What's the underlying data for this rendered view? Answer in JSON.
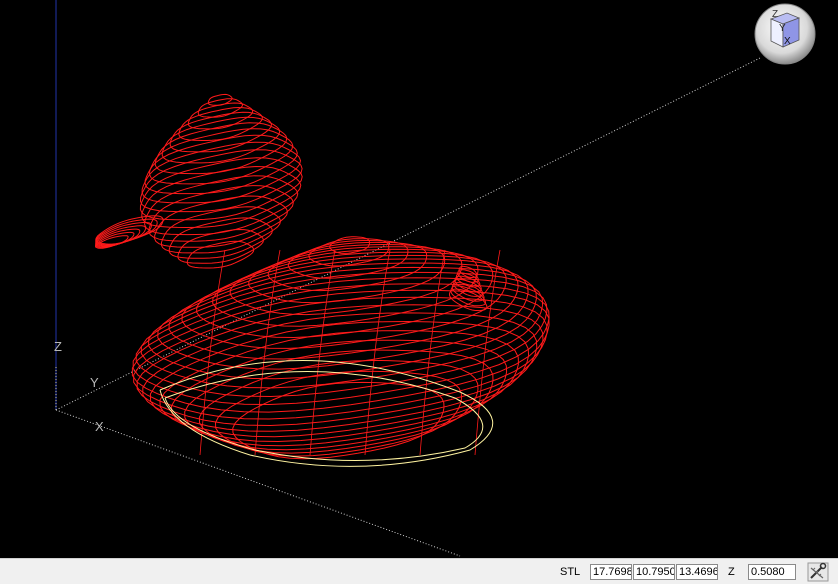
{
  "viewport": {
    "background": "#000000",
    "model_color": "#ff1a1a",
    "toolpath_color": "#fff3a0",
    "axis_labels": {
      "x": "X",
      "y": "Y",
      "z": "Z"
    }
  },
  "view_cube": {
    "top": "Z",
    "front": "Y",
    "right": "X",
    "color": "#8f95e6"
  },
  "statusbar": {
    "mode_label": "STL",
    "coord_x": "17.7698",
    "coord_y": "10.7950",
    "coord_z": "13.4696",
    "z_label": "Z",
    "z_value": "0.5080",
    "icon": "wrench-ruler-icon"
  }
}
